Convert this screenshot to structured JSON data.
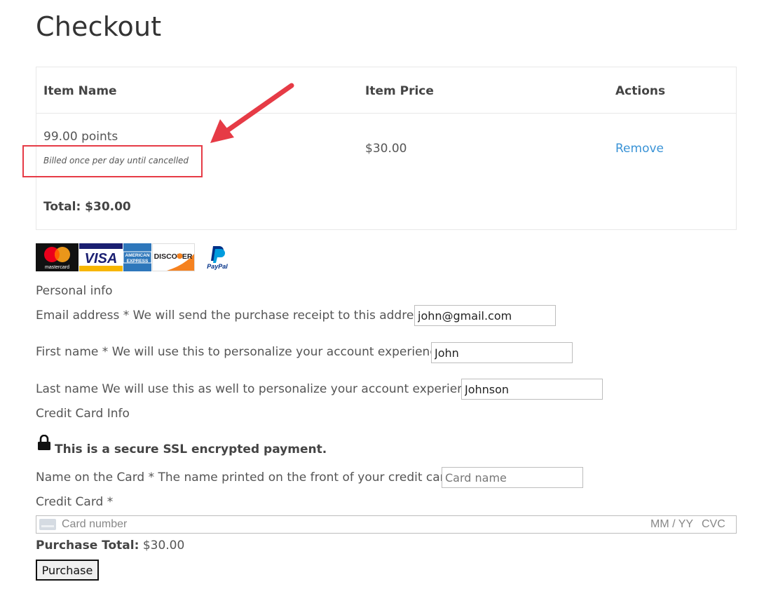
{
  "page_title": "Checkout",
  "cart": {
    "headers": {
      "name": "Item Name",
      "price": "Item Price",
      "actions": "Actions"
    },
    "item": {
      "name": "99.00 points",
      "billing_note": "Billed once per day until cancelled",
      "price": "$30.00",
      "remove_label": "Remove"
    },
    "total": "Total: $30.00"
  },
  "payment_logos": {
    "mastercard": "mastercard",
    "visa": "VISA",
    "amex_line1": "AMERICAN",
    "amex_line2": "EXPRESS",
    "discover": "DISCOVER",
    "paypal": "PayPal"
  },
  "personal_info": {
    "heading": "Personal info",
    "email_label": "Email address * We will send the purchase receipt to this address.",
    "email_value": "john@gmail.com",
    "first_name_label": "First name * We will use this to personalize your account experience.",
    "first_name_value": "John",
    "last_name_label": "Last name We will use this as well to personalize your account experience.",
    "last_name_value": "Johnson"
  },
  "credit_card_info": {
    "heading": "Credit Card Info",
    "secure_note": "This is a secure SSL encrypted payment.",
    "name_on_card_label": "Name on the Card * The name printed on the front of your credit card.",
    "name_on_card_placeholder": "Card name",
    "credit_card_label": "Credit Card *",
    "card_number_placeholder": "Card number",
    "expiry_placeholder": "MM / YY",
    "cvc_placeholder": "CVC"
  },
  "purchase": {
    "total_label": "Purchase Total:",
    "total_value": "$30.00",
    "button_label": "Purchase"
  },
  "colors": {
    "link": "#3a93d6",
    "annotation": "#e63b46"
  }
}
